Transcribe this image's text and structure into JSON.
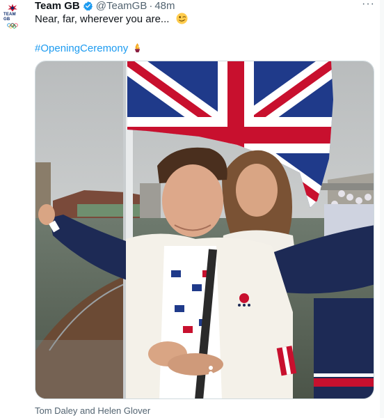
{
  "account": {
    "display_name": "Team GB",
    "handle": "@TeamGB",
    "separator": "·",
    "time_ago": "48m",
    "avatar_text": "TEAM GB"
  },
  "tweet": {
    "text": "Near, far, wherever you are...",
    "emoji": "winking-face",
    "hashtag": "#OpeningCeremony",
    "hashflag_icon": "olympic-torch"
  },
  "media": {
    "alt_description": "photo-of-two-athletes-with-union-jack-flag",
    "caption": "Tom Daley and Helen Glover"
  },
  "colors": {
    "link": "#1d9bf0",
    "secondary_text": "#536471",
    "verified": "#1d9bf0",
    "border": "#cfd9de"
  }
}
